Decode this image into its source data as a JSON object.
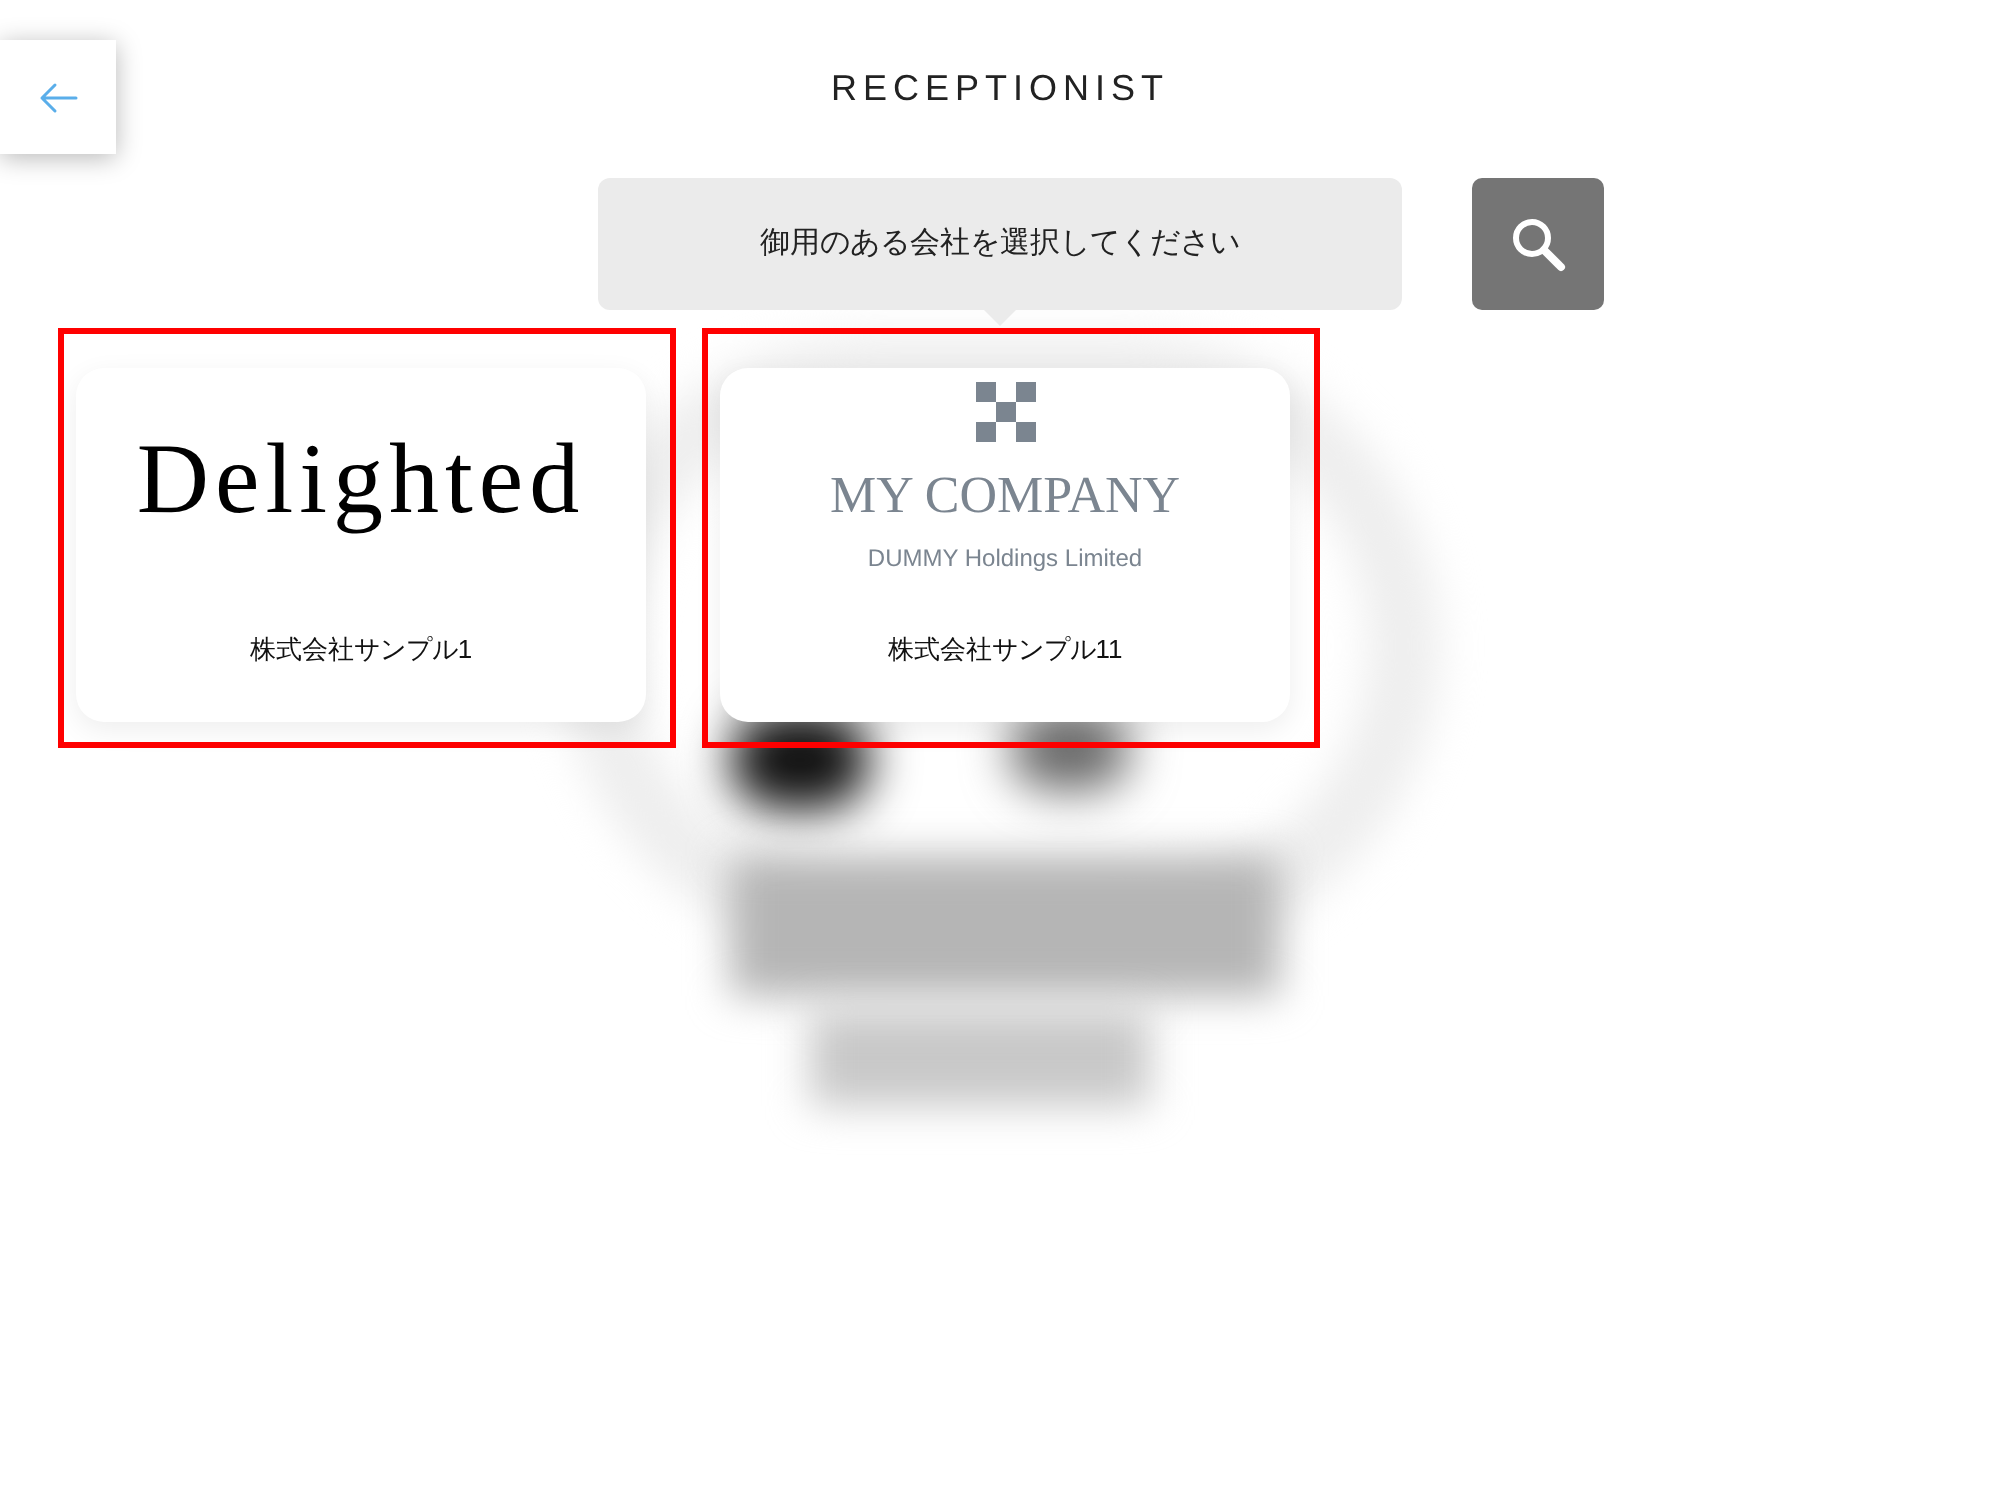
{
  "header": {
    "title": "RECEPTIONIST"
  },
  "prompt": {
    "text": "御用のある会社を選択してください"
  },
  "companies": [
    {
      "kind": "wordmark",
      "logo_text": "Delighted",
      "name": "株式会社サンプル1",
      "highlighted": true
    },
    {
      "kind": "emblem",
      "logo_text": "MY COMPANY",
      "logo_subtext": "DUMMY Holdings Limited",
      "name": "株式会社サンプル11",
      "highlighted": true
    }
  ]
}
